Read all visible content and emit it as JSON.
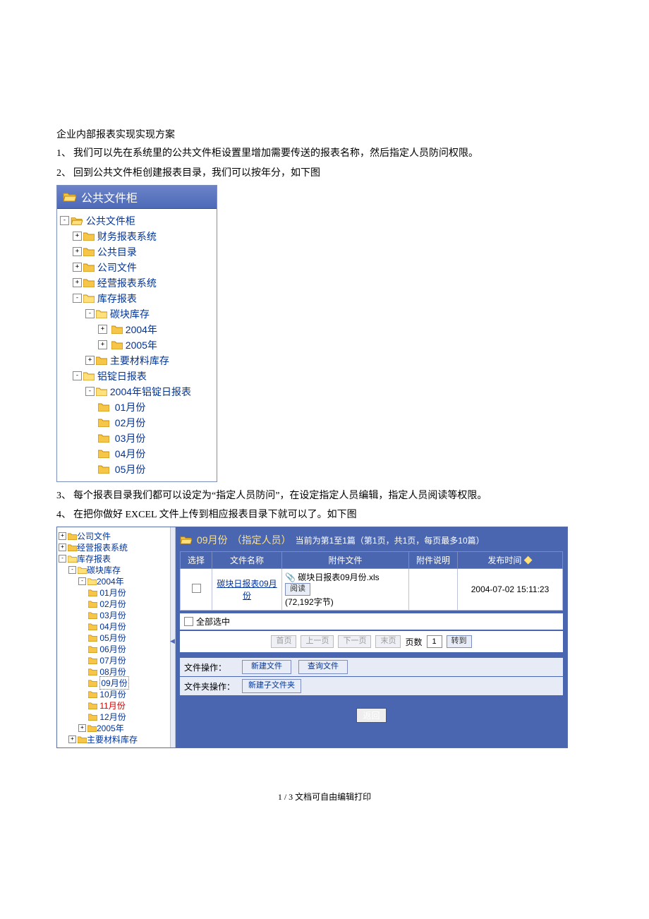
{
  "doc": {
    "title": "企业内部报表实现实现方案",
    "items": [
      "我们可以先在系统里的公共文件柜设置里增加需要传送的报表名称，然后指定人员防问权限。",
      "回到公共文件柜创建报表目录，我们可以按年分，如下图",
      "每个报表目录我们都可以设定为“指定人员防问”，在设定指定人员编辑，指定人员阅读等权限。",
      "在把你做好 EXCEL 文件上传到相应报表目录下就可以了。如下图"
    ],
    "footer": "1 / 3 文档可自由编辑打印"
  },
  "tree1": {
    "header": "公共文件柜",
    "root": "公共文件柜",
    "n1": "财务报表系统",
    "n2": "公共目录",
    "n3": "公司文件",
    "n4": "经营报表系统",
    "n5": "库存报表",
    "n5a": "碳块库存",
    "n5a1": "2004年",
    "n5a2": "2005年",
    "n5b": "主要材料库存",
    "n6": "铝锭日报表",
    "n6a": "2004年铝锭日报表",
    "m1": "01月份",
    "m2": "02月份",
    "m3": "03月份",
    "m4": "04月份",
    "m5": "05月份"
  },
  "panel2": {
    "tree": {
      "a": "公司文件",
      "b": "经营报表系统",
      "c": "库存报表",
      "c1": "碳块库存",
      "c1y": "2004年",
      "m": [
        "01月份",
        "02月份",
        "03月份",
        "04月份",
        "05月份",
        "06月份",
        "07月份",
        "08月份",
        "09月份",
        "10月份",
        "11月份",
        "12月份"
      ],
      "c1y2": "2005年",
      "c2": "主要材料库存"
    },
    "title": {
      "main": "09月份",
      "role": "（指定人员）",
      "info": "当前为第1至1篇（第1页，共1页，每页最多10篇）"
    },
    "cols": {
      "sel": "选择",
      "name": "文件名称",
      "att": "附件文件",
      "desc": "附件说明",
      "time": "发布时间"
    },
    "row": {
      "name": "碳块日报表09月份",
      "att": "碳块日报表09月份.xls",
      "size": "(72,192字节)",
      "read": "阅读",
      "time": "2004-07-02 15:11:23"
    },
    "selall": "全部选中",
    "pager": {
      "first": "首页",
      "prev": "上一页",
      "next": "下一页",
      "last": "末页",
      "pg": "页数",
      "num": "1",
      "go": "转到"
    },
    "ops": {
      "fileLab": "文件操作：",
      "newFile": "新建文件",
      "query": "查询文件",
      "folderLab": "文件夹操作：",
      "newFolder": "新建子文件夹"
    },
    "back": "返回"
  }
}
